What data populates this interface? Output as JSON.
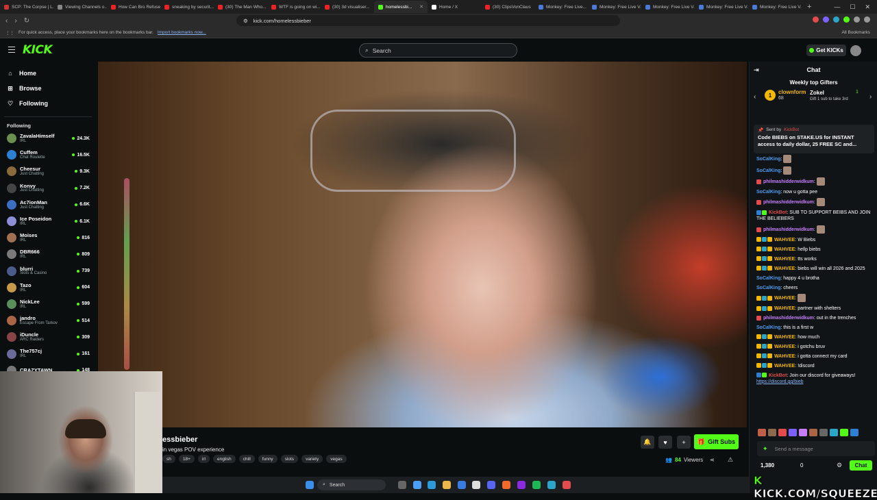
{
  "browser": {
    "tabs": [
      {
        "label": "SCP: The Corpse | L...",
        "color": "#c33",
        "active": false
      },
      {
        "label": "Viewing Channels o...",
        "color": "#888",
        "active": false
      },
      {
        "label": "How Can Bro Refuse...",
        "color": "#e22",
        "active": false
      },
      {
        "label": "sneaking by securit...",
        "color": "#e22",
        "active": false
      },
      {
        "label": "(30) The Man Who...",
        "color": "#e22",
        "active": false
      },
      {
        "label": "WTF is going on wi...",
        "color": "#e22",
        "active": false
      },
      {
        "label": "(30) 3d visualiser...",
        "color": "#e22",
        "active": false
      },
      {
        "label": "homelessbi...",
        "color": "#53fc18",
        "active": true
      },
      {
        "label": "Home / X",
        "color": "#fff",
        "active": false
      },
      {
        "label": "(30) ClipsVonClaus",
        "color": "#e22",
        "active": false
      },
      {
        "label": "Monkey: Free Live...",
        "color": "#4a7bd8",
        "active": false
      },
      {
        "label": "Monkey: Free Live V...",
        "color": "#4a7bd8",
        "active": false
      },
      {
        "label": "Monkey: Free Live V...",
        "color": "#4a7bd8",
        "active": false
      },
      {
        "label": "Monkey: Free Live V...",
        "color": "#4a7bd8",
        "active": false
      },
      {
        "label": "Monkey: Free Live V...",
        "color": "#4a7bd8",
        "active": false
      }
    ],
    "url": "kick.com/homelessbieber",
    "bookmarks_hint": "For quick access, place your bookmarks here on the bookmarks bar.",
    "import_link": "Import bookmarks now...",
    "all_bookmarks": "All Bookmarks"
  },
  "header": {
    "logo": "KICK",
    "search_placeholder": "Search",
    "get_kicks": "Get KICKs"
  },
  "sidebar": {
    "nav": [
      {
        "icon": "⌂",
        "label": "Home"
      },
      {
        "icon": "⊞",
        "label": "Browse"
      },
      {
        "icon": "♡",
        "label": "Following"
      }
    ],
    "following_title": "Following",
    "channels": [
      {
        "name": "ZavalaHimself",
        "category": "IRL",
        "viewers": "24.3K",
        "color": "#6a8f4e"
      },
      {
        "name": "Cuffem",
        "category": "Chat Roulette",
        "viewers": "16.5K",
        "color": "#2d7fd3"
      },
      {
        "name": "Cheesur",
        "category": "Just Chatting",
        "viewers": "9.3K",
        "color": "#8a6a3a"
      },
      {
        "name": "Konvy",
        "category": "Just Chatting",
        "viewers": "7.2K",
        "color": "#444"
      },
      {
        "name": "Ac7ionMan",
        "category": "Just Chatting",
        "viewers": "6.6K",
        "color": "#3c6fc2"
      },
      {
        "name": "Ice Poseidon",
        "category": "IRL",
        "viewers": "6.1K",
        "color": "#8d8dd8"
      },
      {
        "name": "Moises",
        "category": "IRL",
        "viewers": "816",
        "color": "#a07050"
      },
      {
        "name": "DBR666",
        "category": "IRL",
        "viewers": "809",
        "color": "#7a7a7a"
      },
      {
        "name": "blurri",
        "category": "Slots & Casino",
        "viewers": "739",
        "color": "#4c5b8a"
      },
      {
        "name": "Tazo",
        "category": "IRL",
        "viewers": "604",
        "color": "#c79a4a"
      },
      {
        "name": "NickLee",
        "category": "IRL",
        "viewers": "599",
        "color": "#5a8f5a"
      },
      {
        "name": "jandro",
        "category": "Escape From Tarkov",
        "viewers": "514",
        "color": "#aa6644"
      },
      {
        "name": "iDuncle",
        "category": "ARC Raiders",
        "viewers": "309",
        "color": "#884444"
      },
      {
        "name": "The757cj",
        "category": "IRL",
        "viewers": "161",
        "color": "#6b6b9a"
      },
      {
        "name": "CRAZYTAWN",
        "category": "",
        "viewers": "148",
        "color": "#777"
      }
    ]
  },
  "stream": {
    "title": "essbieber",
    "subtitle": "in vegas POV experience",
    "tags": [
      "sh",
      "18+",
      "irl",
      "english",
      "chill",
      "funny",
      "slots",
      "variety",
      "vegas"
    ],
    "gift_subs": "Gift Subs",
    "viewers_count": "84",
    "viewers_label": "Viewers"
  },
  "taskbar": {
    "search": "Search"
  },
  "chat": {
    "title": "Chat",
    "weekly_title": "Weekly top Gifters",
    "gifter1": {
      "rank": "1",
      "name": "clownform",
      "count": "68"
    },
    "gifter2": {
      "name": "Zokel",
      "count": "1",
      "cta": "Gift 1 sub to take 3rd"
    },
    "pinned": {
      "sent_by_label": "Sent by",
      "sender": "KickBot",
      "text": "Code BIEBS on STAKE.US for INSTANT access to daily dollar, 25 FREE SC and..."
    },
    "messages": [
      {
        "user": "SoCalKing",
        "color": "#4a9ef5",
        "text": "",
        "emote": true,
        "badges": []
      },
      {
        "user": "SoCalKing",
        "color": "#4a9ef5",
        "text": "",
        "emote": true,
        "badges": []
      },
      {
        "user": "philmashidderwidkum",
        "color": "#c77dff",
        "text": "",
        "emote": true,
        "badges": [
          "#e34c4c"
        ]
      },
      {
        "user": "SoCalKing",
        "color": "#4a9ef5",
        "text": "now u gotta pee",
        "emote": false,
        "badges": []
      },
      {
        "user": "philmashidderwidkum",
        "color": "#c77dff",
        "text": "",
        "emote": true,
        "badges": [
          "#e34c4c"
        ]
      },
      {
        "user": "KickBot",
        "color": "#e34c4c",
        "text": "SUB TO SUPPORT BEIBS AND JOIN THE BELIEBERS",
        "emote": false,
        "badges": [
          "#2d7fd3",
          "#53fc18"
        ]
      },
      {
        "user": "philmashidderwidkum",
        "color": "#c77dff",
        "text": "",
        "emote": true,
        "badges": [
          "#e34c4c"
        ]
      },
      {
        "user": "WAHVEE",
        "color": "#f5b800",
        "text": "W Biebs",
        "emote": false,
        "badges": [
          "#f5b800",
          "#2aa6c9",
          "#f5b800"
        ]
      },
      {
        "user": "WAHVEE",
        "color": "#f5b800",
        "text": "hellp biebs",
        "emote": false,
        "badges": [
          "#f5b800",
          "#2aa6c9",
          "#f5b800"
        ]
      },
      {
        "user": "WAHVEE",
        "color": "#f5b800",
        "text": "tts works",
        "emote": false,
        "badges": [
          "#f5b800",
          "#2aa6c9",
          "#f5b800"
        ]
      },
      {
        "user": "WAHVEE",
        "color": "#f5b800",
        "text": "biebs will win all 2026 and 2025",
        "emote": false,
        "badges": [
          "#f5b800",
          "#2aa6c9",
          "#f5b800"
        ]
      },
      {
        "user": "SoCalKing",
        "color": "#4a9ef5",
        "text": "happy 4 u brotha",
        "emote": false,
        "badges": []
      },
      {
        "user": "SoCalKing",
        "color": "#4a9ef5",
        "text": "cheers",
        "emote": false,
        "badges": []
      },
      {
        "user": "WAHVEE",
        "color": "#f5b800",
        "text": "",
        "emote": true,
        "badges": [
          "#f5b800",
          "#2aa6c9",
          "#f5b800"
        ]
      },
      {
        "user": "WAHVEE",
        "color": "#f5b800",
        "text": "partner with shelters",
        "emote": false,
        "badges": [
          "#f5b800",
          "#2aa6c9",
          "#f5b800"
        ]
      },
      {
        "user": "philmashidderwidkum",
        "color": "#c77dff",
        "text": "out in the trenches",
        "emote": false,
        "badges": [
          "#e34c4c"
        ]
      },
      {
        "user": "SoCalKing",
        "color": "#4a9ef5",
        "text": "this is a first w",
        "emote": false,
        "badges": []
      },
      {
        "user": "WAHVEE",
        "color": "#f5b800",
        "text": "how much",
        "emote": false,
        "badges": [
          "#f5b800",
          "#2aa6c9",
          "#f5b800"
        ]
      },
      {
        "user": "WAHVEE",
        "color": "#f5b800",
        "text": "i gotchu bruv",
        "emote": false,
        "badges": [
          "#f5b800",
          "#2aa6c9",
          "#f5b800"
        ]
      },
      {
        "user": "WAHVEE",
        "color": "#f5b800",
        "text": "i gotta connect my card",
        "emote": false,
        "badges": [
          "#f5b800",
          "#2aa6c9",
          "#f5b800"
        ]
      },
      {
        "user": "WAHVEE",
        "color": "#f5b800",
        "text": "!discord",
        "emote": false,
        "badges": [
          "#f5b800",
          "#2aa6c9",
          "#f5b800"
        ]
      },
      {
        "user": "KickBot",
        "color": "#e34c4c",
        "text": "Join our discord for giveaways!",
        "link": "https://discord.gg/bieb",
        "emote": false,
        "badges": [
          "#2d7fd3",
          "#53fc18"
        ]
      }
    ],
    "input_placeholder": "Send a message",
    "points": "1,380",
    "zero": "0",
    "chat_button": "Chat"
  },
  "watermark": {
    "k": "K",
    "text": " KICK.COM/SQUEEZE"
  }
}
